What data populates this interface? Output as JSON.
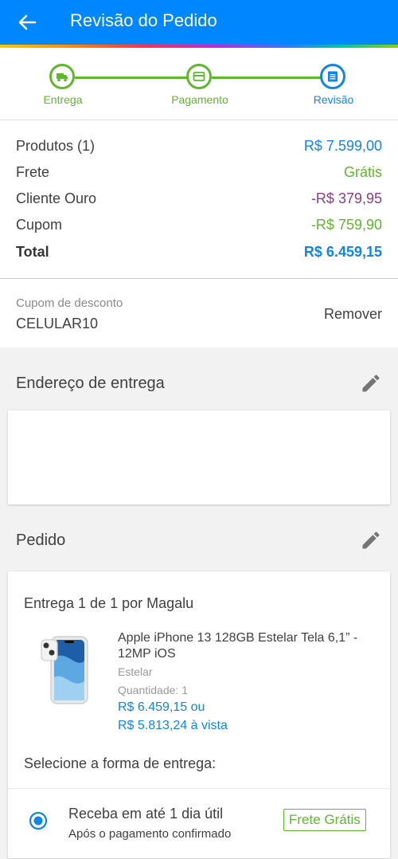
{
  "header": {
    "title": "Revisão do Pedido"
  },
  "steps": [
    {
      "label": "Entrega",
      "icon": "truck-icon",
      "color": "#5fb72d"
    },
    {
      "label": "Pagamento",
      "icon": "card-icon",
      "color": "#5fb72d"
    },
    {
      "label": "Revisão",
      "icon": "list-icon",
      "color": "#0f86e6"
    }
  ],
  "summary": {
    "products_label": "Produtos (1)",
    "products_value": "R$ 7.599,00",
    "shipping_label": "Frete",
    "shipping_value": "Grátis",
    "gold_label": "Cliente Ouro",
    "gold_value": "-R$ 379,95",
    "coupon_label": "Cupom",
    "coupon_value": "-R$ 759,90",
    "total_label": "Total",
    "total_value": "R$ 6.459,15"
  },
  "coupon": {
    "caption": "Cupom de desconto",
    "code": "CELULAR10",
    "remove_label": "Remover"
  },
  "address": {
    "title": "Endereço de entrega"
  },
  "order": {
    "title": "Pedido",
    "delivery_header": "Entrega 1 de 1 por Magalu",
    "product_name": "Apple iPhone 13 128GB Estelar Tela 6,1” - 12MP iOS",
    "variant": "Estelar",
    "quantity_label": "Quantidade:",
    "quantity": "1",
    "price_installments": "R$ 6.459,15 ou",
    "price_cash": "R$ 5.813,24 à vista",
    "shipping_prompt": "Selecione a forma de entrega:",
    "option_title": "Receba em até 1 dia útil",
    "option_sub": "Após o pagamento confirmado",
    "option_badge": "Frete Grátis"
  },
  "colors": {
    "primary": "#0086ff",
    "accent_blue": "#0f86e6",
    "green": "#5fb72d",
    "purple": "#8c3c8c"
  }
}
